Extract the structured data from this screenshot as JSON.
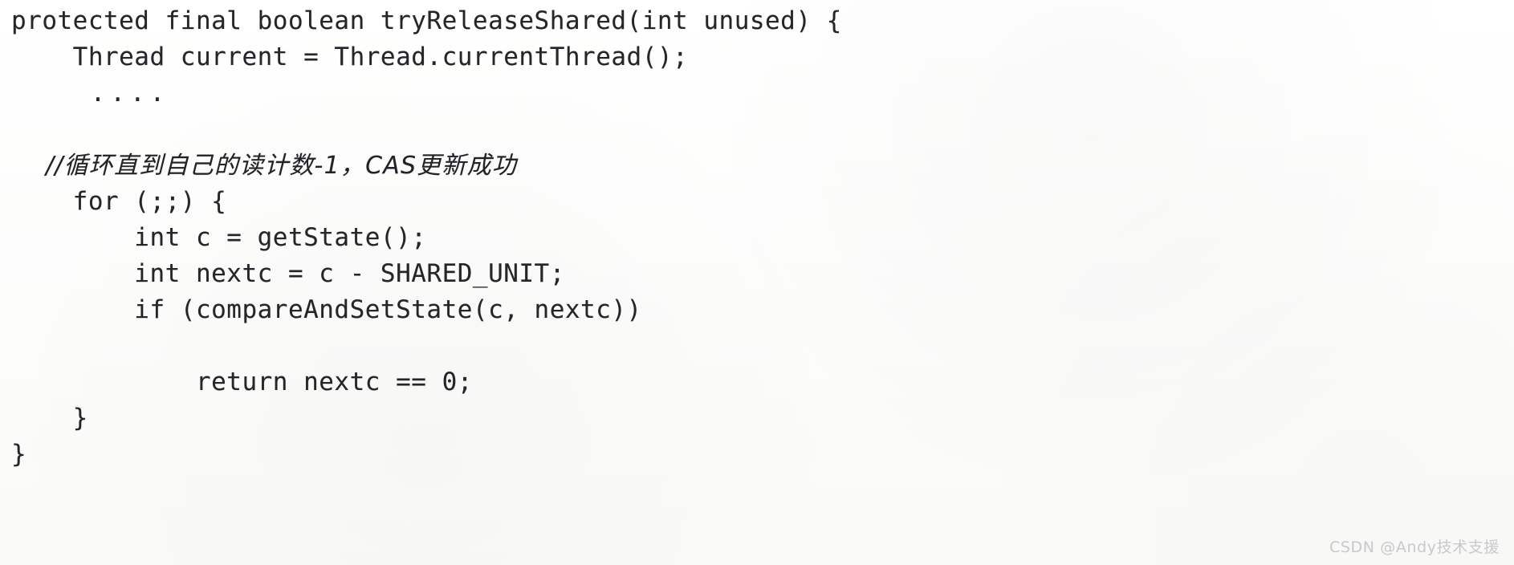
{
  "document": {
    "kind": "scanned-code-listing",
    "language": "java",
    "background_color": "#fdfdfc",
    "text_color": "#26262a",
    "lines": [
      {
        "text": "protected final boolean tryReleaseShared(int unused) {",
        "style": "code"
      },
      {
        "text": "    Thread current = Thread.currentThread();",
        "style": "code"
      },
      {
        "text": "    ....",
        "style": "dots"
      },
      {
        "text": " ",
        "style": "blank"
      },
      {
        "text": "    //循环直到自己的读计数-1，CAS更新成功",
        "style": "comment"
      },
      {
        "text": "    for (;;) {",
        "style": "code"
      },
      {
        "text": "        int c = getState();",
        "style": "code"
      },
      {
        "text": "        int nextc = c - SHARED_UNIT;",
        "style": "code"
      },
      {
        "text": "        if (compareAndSetState(c, nextc))",
        "style": "code"
      },
      {
        "text": " ",
        "style": "blank"
      },
      {
        "text": "            return nextc == 0;",
        "style": "code"
      },
      {
        "text": "    }",
        "style": "code"
      },
      {
        "text": "}",
        "style": "code"
      }
    ]
  },
  "watermark": {
    "text": "CSDN @Andy技术支援",
    "color": "#c9c9cc"
  }
}
